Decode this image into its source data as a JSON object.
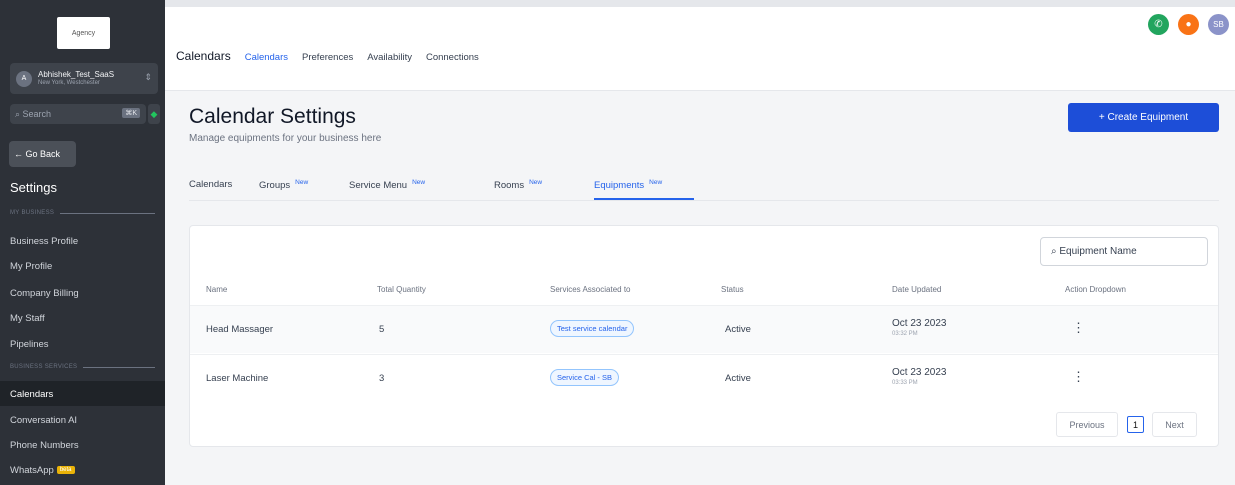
{
  "sidebar": {
    "logo_text": "Agency",
    "account": {
      "avatar": "A",
      "name": "Abhishek_Test_SaaS",
      "location": "New York, Westchester"
    },
    "search_placeholder": "Search",
    "search_shortcut": "⌘K",
    "go_back": "← Go Back",
    "heading": "Settings",
    "section_my_business": "MY BUSINESS",
    "section_business_services": "BUSINESS SERVICES",
    "items": [
      "Business Profile",
      "My Profile",
      "Company Billing",
      "My Staff",
      "Pipelines"
    ],
    "service_items": [
      "Calendars",
      "Conversation AI",
      "Phone Numbers",
      "WhatsApp"
    ],
    "beta_label": "beta"
  },
  "topbar": {
    "title": "Calendars",
    "tabs": [
      "Calendars",
      "Preferences",
      "Availability",
      "Connections"
    ],
    "avatar_initials": "SB"
  },
  "page": {
    "title": "Calendar Settings",
    "subtitle": "Manage equipments for your business here",
    "create_button": "+ Create Equipment"
  },
  "subtabs": [
    {
      "label": "Calendars",
      "badge": ""
    },
    {
      "label": "Groups",
      "badge": "New"
    },
    {
      "label": "Service Menu",
      "badge": "New"
    },
    {
      "label": "Rooms",
      "badge": "New"
    },
    {
      "label": "Equipments",
      "badge": "New"
    }
  ],
  "table": {
    "filter_placeholder": "Equipment Name",
    "headers": [
      "Name",
      "Total Quantity",
      "Services Associated to",
      "Status",
      "Date Updated",
      "Action Dropdown"
    ],
    "rows": [
      {
        "name": "Head Massager",
        "qty": "5",
        "service": "Test service calendar",
        "status": "Active",
        "date": "Oct 23 2023",
        "time": "03:32 PM"
      },
      {
        "name": "Laser Machine",
        "qty": "3",
        "service": "Service Cal - SB",
        "status": "Active",
        "date": "Oct 23 2023",
        "time": "03:33 PM"
      }
    ]
  },
  "pagination": {
    "previous": "Previous",
    "page": "1",
    "next": "Next"
  },
  "colors": {
    "accent": "#1d4ed8",
    "sidebar": "#2d3138",
    "phone": "#22a55e",
    "notify": "#f97316",
    "avatar": "#8b93c9"
  }
}
